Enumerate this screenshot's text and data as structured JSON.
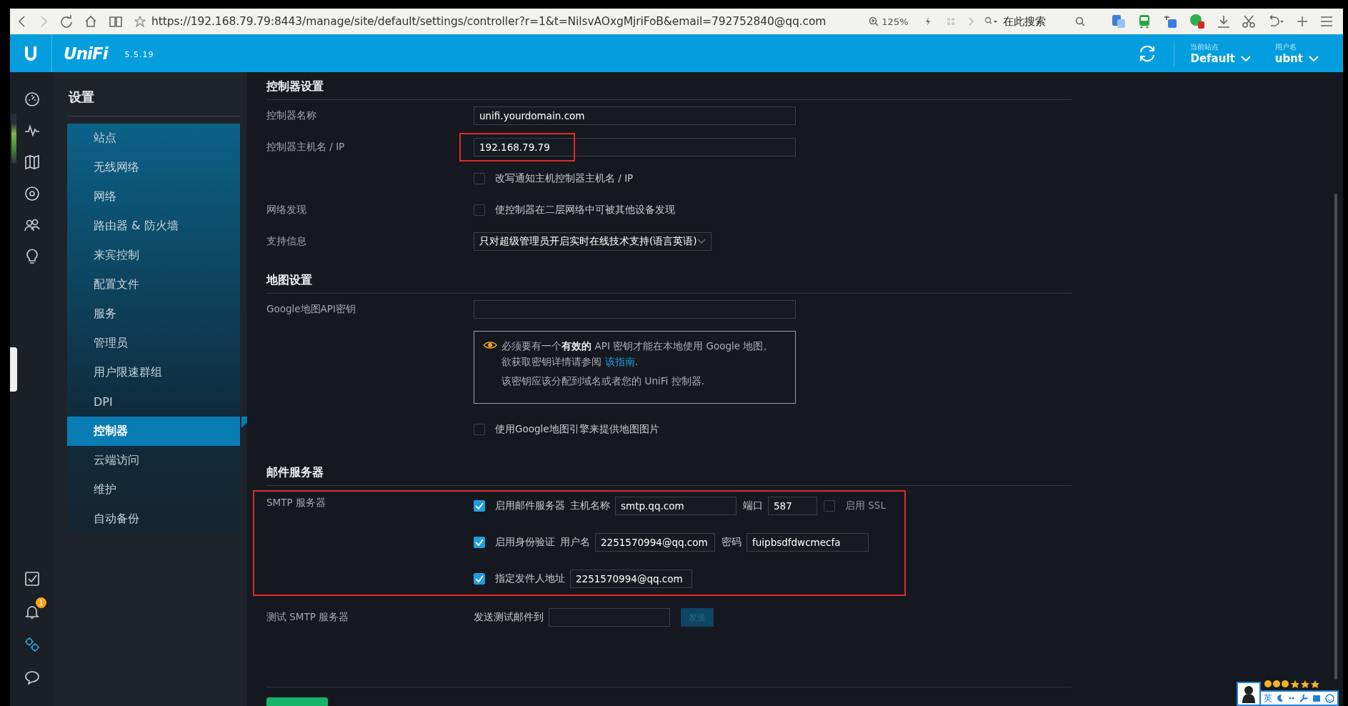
{
  "browser": {
    "url": "https://192.168.79.79:8443/manage/site/default/settings/controller?r=1&t=NilsvAOxgMjriFoB&email=792752840@qq.com",
    "zoom": "125%",
    "search_placeholder": "在此搜索"
  },
  "header": {
    "logo": "UniFi",
    "version": "5.5.19",
    "site_label": "当前站点",
    "site": "Default",
    "user_label": "用户名",
    "user": "ubnt"
  },
  "rail": {
    "top_items": [
      {
        "kind": "dashboard",
        "selected": false
      },
      {
        "kind": "statistics",
        "selected": false
      },
      {
        "kind": "map",
        "selected": false
      },
      {
        "kind": "devices",
        "selected": false
      },
      {
        "kind": "clients",
        "selected": false
      },
      {
        "kind": "insights",
        "selected": false
      }
    ],
    "bottom_items": [
      {
        "kind": "tasks",
        "selected": false
      },
      {
        "kind": "alerts",
        "selected": false,
        "badge": "1"
      },
      {
        "kind": "settings",
        "selected": true
      },
      {
        "kind": "chat",
        "selected": false
      }
    ]
  },
  "nav": {
    "title": "设置",
    "items": [
      {
        "label": "站点",
        "selected": false
      },
      {
        "label": "无线网络",
        "selected": false
      },
      {
        "label": "网络",
        "selected": false
      },
      {
        "label": "路由器 & 防火墙",
        "selected": false
      },
      {
        "label": "来宾控制",
        "selected": false
      },
      {
        "label": "配置文件",
        "selected": false
      },
      {
        "label": "服务",
        "selected": false
      },
      {
        "label": "管理员",
        "selected": false
      },
      {
        "label": "用户限速群组",
        "selected": false
      },
      {
        "label": "DPI",
        "selected": false
      },
      {
        "label": "控制器",
        "selected": true
      },
      {
        "label": "云端访问",
        "selected": false
      },
      {
        "label": "维护",
        "selected": false
      },
      {
        "label": "自动备份",
        "selected": false
      }
    ]
  },
  "controller_settings": {
    "title": "控制器设置",
    "name_label": "控制器名称",
    "name_value": "unifi.yourdomain.com",
    "host_label": "控制器主机名 / IP",
    "host_value": "192.168.79.79",
    "host_highlighted": true,
    "override": {
      "label": "改写通知主机控制器主机名 / IP",
      "checked": false
    },
    "discovery_label": "网络发现",
    "discovery": {
      "label": "使控制器在二层网络中可被其他设备发现",
      "checked": false
    },
    "support_label": "支持信息",
    "support_value": "只对超级管理员开启实时在线技术支持(语言英语)"
  },
  "map_settings": {
    "title": "地图设置",
    "key_label": "Google地图API密钥",
    "notice": "必须要有一个**有效的** API 密钥才能在本地使用 Google 地图。欲获取密钥详情请参阅 ",
    "notice_link": "该指南",
    "notice_end": ".",
    "notice_2": "该密钥应该分配到域名或者您的 UniFi 控制器.",
    "static_maps": {
      "label": "使用Google地图引擎来提供地图图片",
      "checked": false
    }
  },
  "mail_server": {
    "title": "邮件服务器",
    "highlighted": true,
    "smtp_label": "SMTP 服务器",
    "enable": {
      "label": "启用邮件服务器",
      "checked": true
    },
    "host_label": "主机名称",
    "host": "smtp.qq.com",
    "port_label": "端口",
    "port": "587",
    "ssl": {
      "label": "启用 SSL",
      "checked": false
    },
    "auth": {
      "label": "启用身份验证",
      "checked": true
    },
    "user_label": "用户名",
    "user": "2251570994@qq.com",
    "password_label": "密码",
    "password": "fuipbsdfdwcmecfa",
    "sender": {
      "label": "指定发件人地址",
      "checked": true
    },
    "sender_value": "2251570994@qq.com",
    "test_label": "测试 SMTP 服务器",
    "send_to_label": "发送测试邮件到",
    "send_button": "发送"
  },
  "ime": {
    "language": "英"
  }
}
